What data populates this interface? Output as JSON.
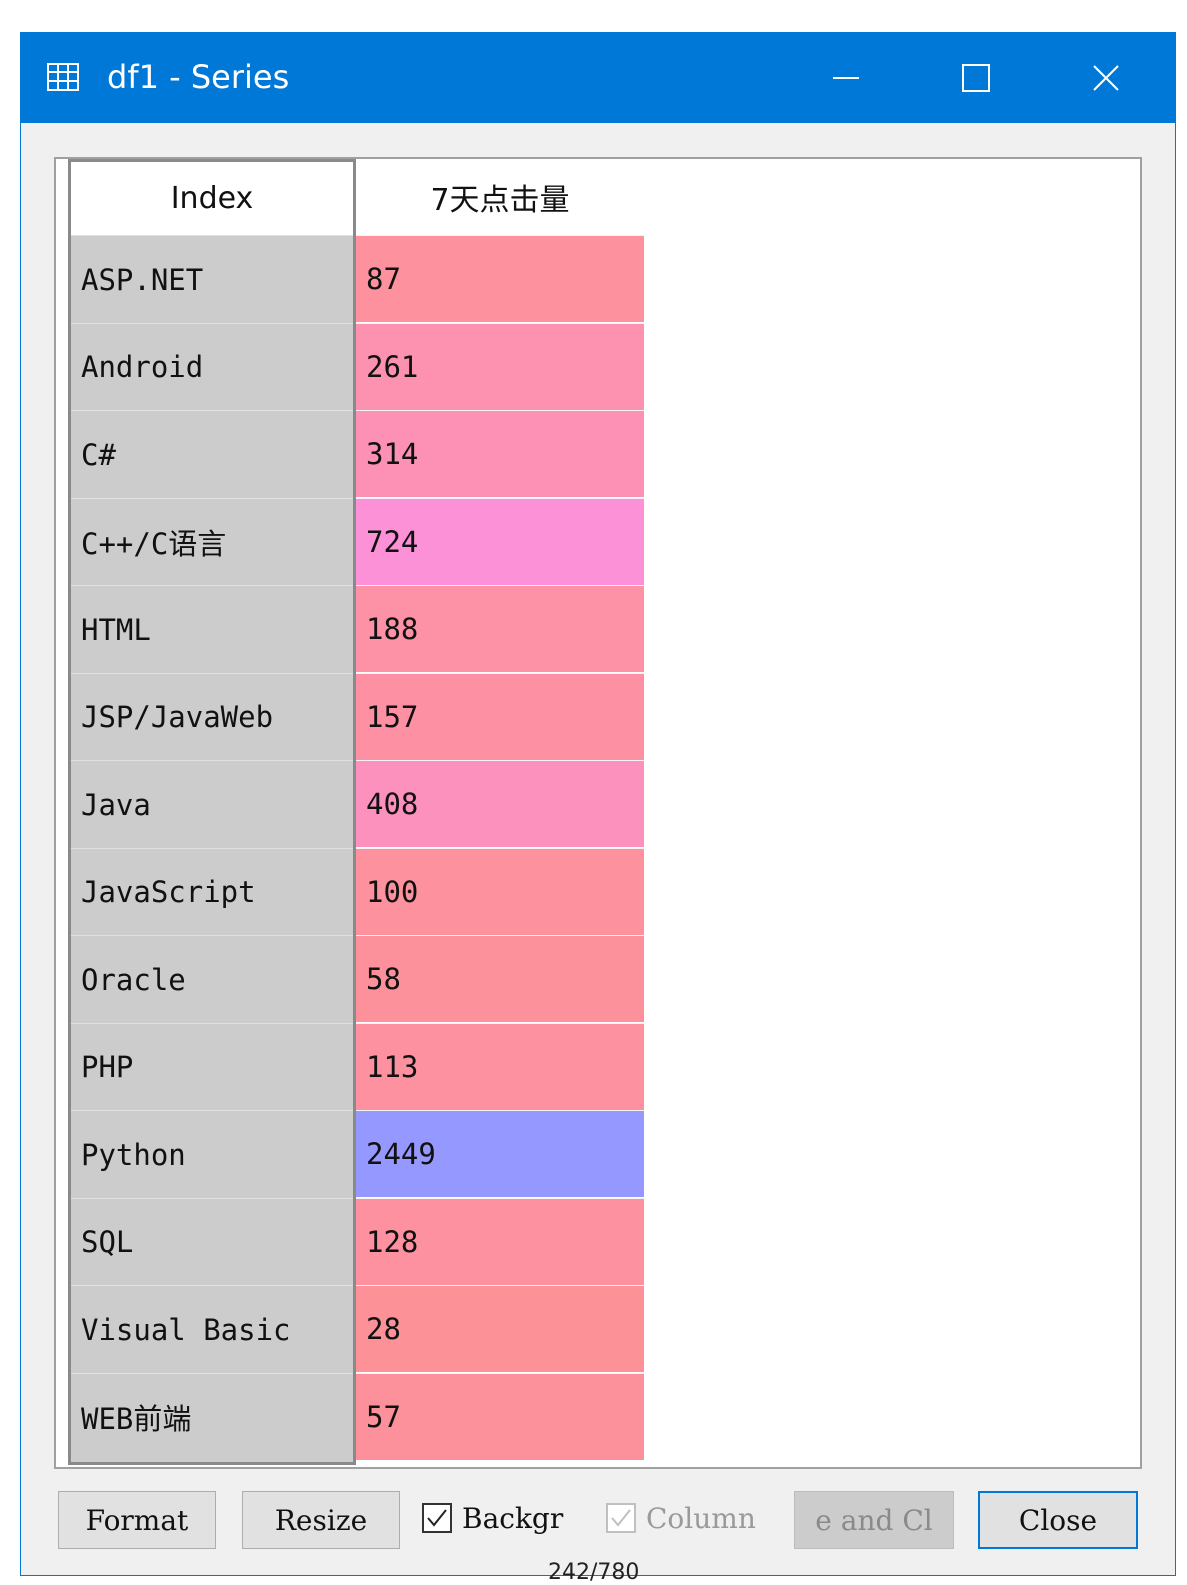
{
  "window": {
    "title": "df1 - Series",
    "icon": "table-icon",
    "controls": [
      "minimize-icon",
      "maximize-icon",
      "close-icon"
    ],
    "accent_color": "#0078d7"
  },
  "table": {
    "index_header": "Index",
    "value_header": "7天点击量",
    "rows": [
      {
        "label": "ASP.NET",
        "value": "87",
        "color": "#fd919d"
      },
      {
        "label": "Android",
        "value": "261",
        "color": "#fd91b0"
      },
      {
        "label": "C#",
        "value": "314",
        "color": "#fd91b5"
      },
      {
        "label": "C++/C语言",
        "value": "724",
        "color": "#fd91d8"
      },
      {
        "label": "HTML",
        "value": "188",
        "color": "#fd91a6"
      },
      {
        "label": "JSP/JavaWeb",
        "value": "157",
        "color": "#fd91a3"
      },
      {
        "label": "Java",
        "value": "408",
        "color": "#fd91be"
      },
      {
        "label": "JavaScript",
        "value": "100",
        "color": "#fd919e"
      },
      {
        "label": "Oracle",
        "value": "58",
        "color": "#fd919b"
      },
      {
        "label": "PHP",
        "value": "113",
        "color": "#fd919f"
      },
      {
        "label": "Python",
        "value": "2449",
        "color": "#9598ff"
      },
      {
        "label": "SQL",
        "value": "128",
        "color": "#fd91a0"
      },
      {
        "label": "Visual Basic",
        "value": "28",
        "color": "#fd9198"
      },
      {
        "label": "WEB前端",
        "value": "57",
        "color": "#fd919b"
      }
    ]
  },
  "buttons": {
    "format": "Format",
    "resize": "Resize",
    "background_checkbox": "Backgr",
    "column_checkbox": "Column",
    "save_close": "e and Cl",
    "close": "Close"
  },
  "checkboxes": {
    "background_checked": true,
    "column_checked": true,
    "column_enabled": false
  },
  "footer": "242/780"
}
